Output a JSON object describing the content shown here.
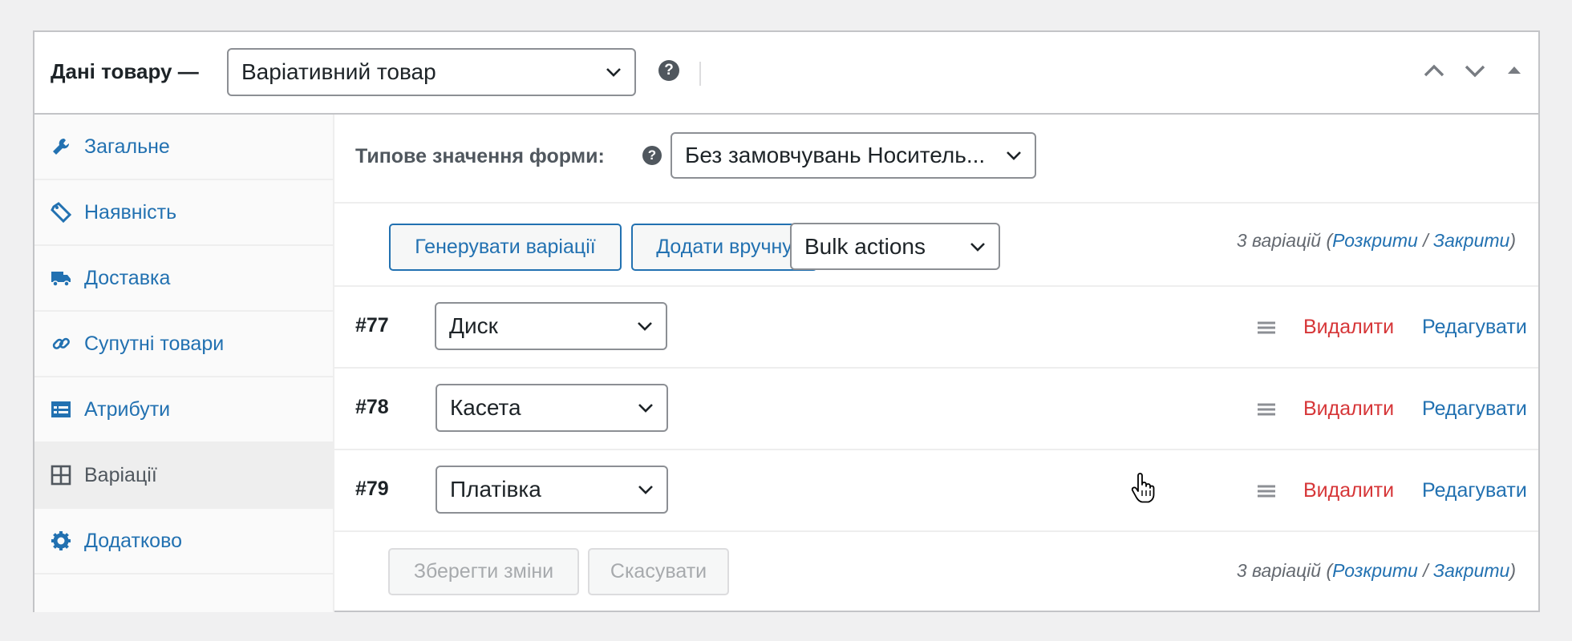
{
  "header": {
    "title": "Дані товару —",
    "product_type": "Варіативний товар",
    "help_icon": "question-icon",
    "controls": [
      "chevron-up-icon",
      "chevron-down-icon",
      "triangle-up-icon"
    ]
  },
  "sidebar": {
    "items": [
      {
        "label": "Загальне",
        "icon": "wrench-icon",
        "active": false
      },
      {
        "label": "Наявність",
        "icon": "tag-icon",
        "active": false
      },
      {
        "label": "Доставка",
        "icon": "truck-icon",
        "active": false
      },
      {
        "label": "Супутні товари",
        "icon": "link-icon",
        "active": false
      },
      {
        "label": "Атрибути",
        "icon": "list-icon",
        "active": false
      },
      {
        "label": "Варіації",
        "icon": "grid-icon",
        "active": true
      },
      {
        "label": "Додатково",
        "icon": "gear-icon",
        "active": false
      }
    ]
  },
  "defaults": {
    "label": "Типове значення форми:",
    "select_value": "Без замовчувань Носитель..."
  },
  "toolbar": {
    "generate_label": "Генерувати варіації",
    "add_label": "Додати вручну",
    "bulk_value": "Bulk actions"
  },
  "summary": {
    "count_text": "3 варіацій (",
    "expand": "Розкрити",
    "separator": " / ",
    "collapse": "Закрити",
    "close_paren": ")"
  },
  "variations": [
    {
      "id": "#77",
      "value": "Диск",
      "delete": "Видалити",
      "edit": "Редагувати"
    },
    {
      "id": "#78",
      "value": "Касета",
      "delete": "Видалити",
      "edit": "Редагувати"
    },
    {
      "id": "#79",
      "value": "Платівка",
      "delete": "Видалити",
      "edit": "Редагувати"
    }
  ],
  "footer": {
    "save_label": "Зберегти зміни",
    "cancel_label": "Скасувати"
  },
  "colors": {
    "link": "#2271b1",
    "delete": "#d63638",
    "disabled": "#a7aaad"
  }
}
